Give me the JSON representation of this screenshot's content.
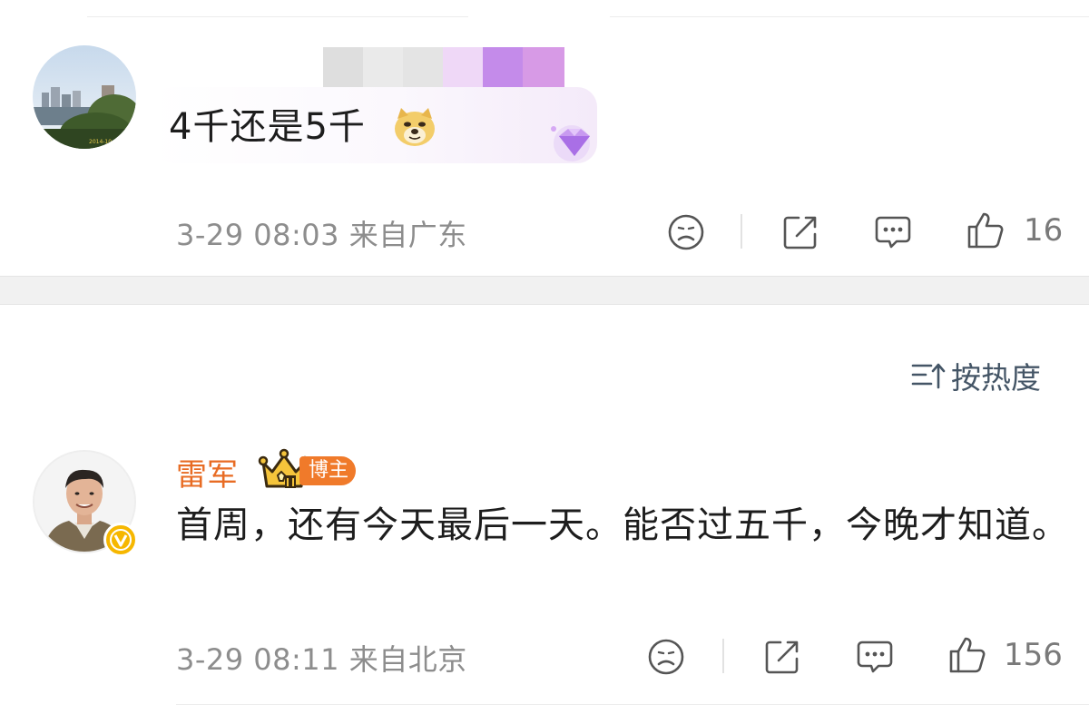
{
  "comments": [
    {
      "text": "4千还是5千",
      "emoji": "doge-emoji",
      "timestamp": "3-29 08:03",
      "location": "来自广东",
      "like_count": "16",
      "actions": [
        "sad-face-icon",
        "share-icon",
        "comment-icon",
        "like-icon"
      ]
    },
    {
      "username": "雷军",
      "badge": "博主",
      "text": "首周，还有今天最后一天。能否过五千，今晚才知道。",
      "timestamp": "3-29 08:11",
      "location": "来自北京",
      "like_count": "156",
      "actions": [
        "sad-face-icon",
        "share-icon",
        "comment-icon",
        "like-icon"
      ]
    }
  ],
  "sort": {
    "label": "按热度",
    "icon": "sort-icon"
  },
  "colors": {
    "username": "#e86c24",
    "meta": "#8d8d8d",
    "badge_bg": "#f07a2a",
    "sort": "#445566"
  }
}
